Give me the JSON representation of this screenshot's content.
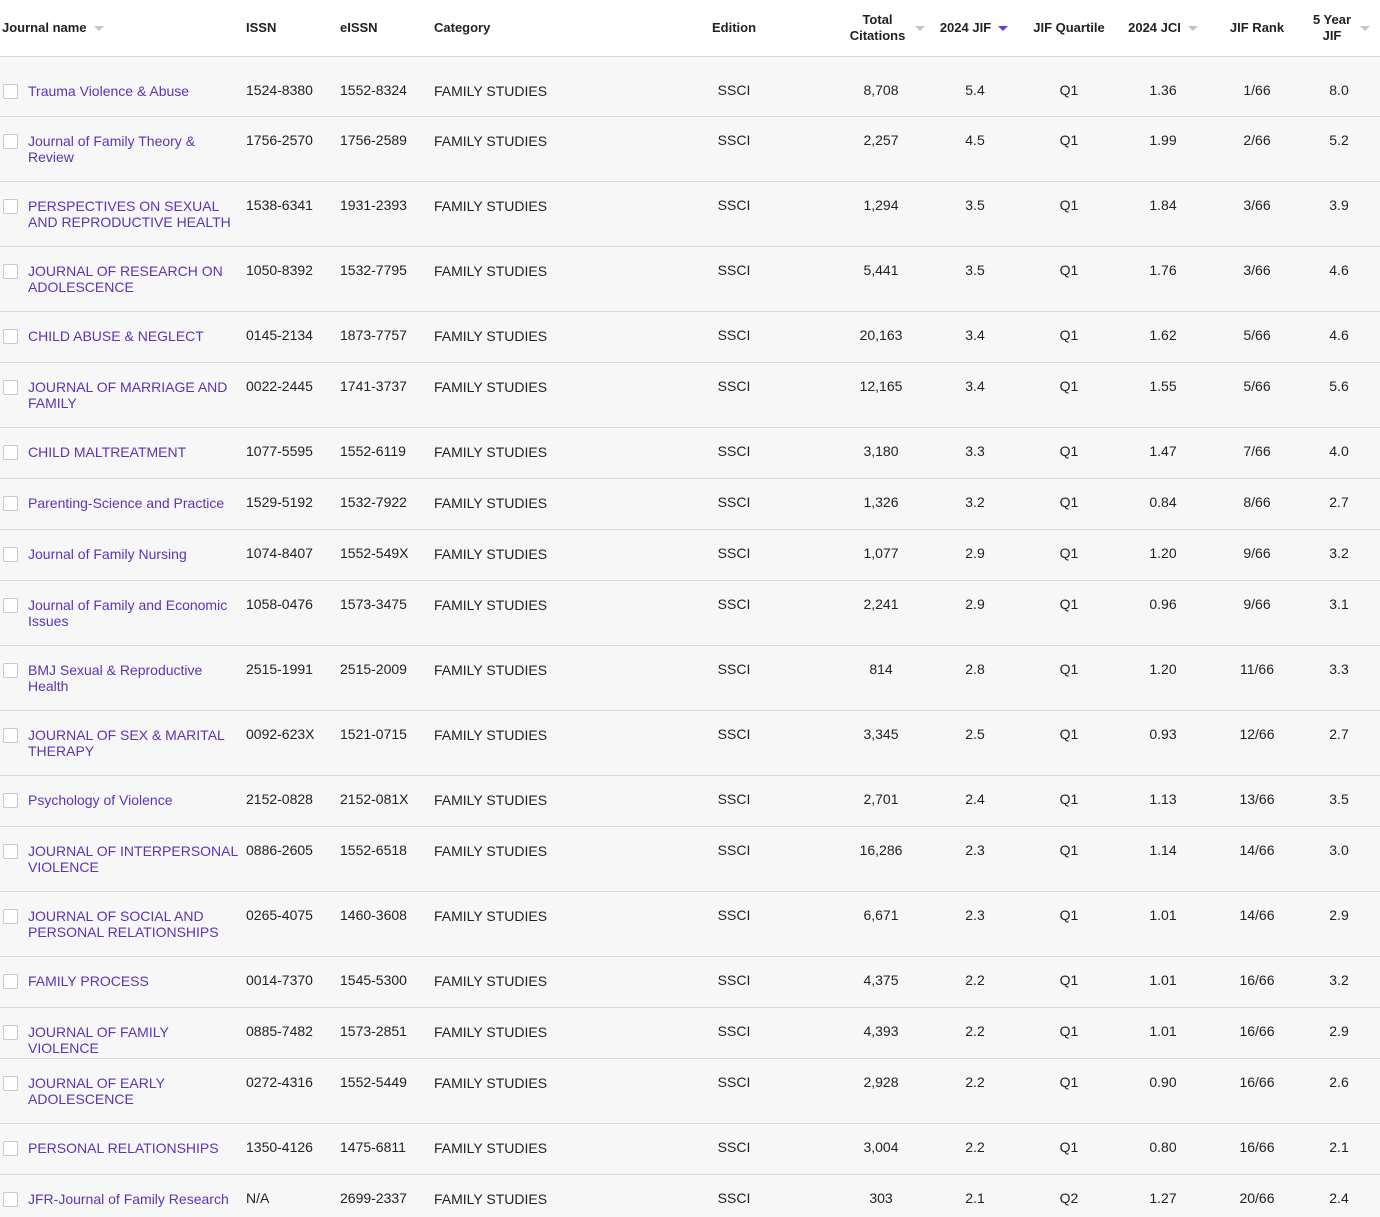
{
  "columns": {
    "journal_name": "Journal name",
    "issn": "ISSN",
    "eissn": "eISSN",
    "category": "Category",
    "edition": "Edition",
    "total_citations": "Total Citations",
    "jif_2024": "2024 JIF",
    "jif_quartile": "JIF Quartile",
    "jci_2024": "2024 JCI",
    "jif_rank": "JIF Rank",
    "five_year_jif": "5 Year JIF"
  },
  "colors": {
    "link": "#5e33b5",
    "sort_active": "#6b3fc8",
    "sort_inactive": "#c4c4c4",
    "row_bg": "#f7f7f7"
  },
  "rows": [
    {
      "name": "Trauma Violence & Abuse",
      "issn": "1524-8380",
      "eissn": "1552-8324",
      "category": "FAMILY STUDIES",
      "edition": "SSCI",
      "citations": "8,708",
      "jif": "5.4",
      "quartile": "Q1",
      "jci": "1.36",
      "rank": "1/66",
      "jif5": "8.0"
    },
    {
      "name": "Journal of Family Theory & Review",
      "issn": "1756-2570",
      "eissn": "1756-2589",
      "category": "FAMILY STUDIES",
      "edition": "SSCI",
      "citations": "2,257",
      "jif": "4.5",
      "quartile": "Q1",
      "jci": "1.99",
      "rank": "2/66",
      "jif5": "5.2"
    },
    {
      "name": "PERSPECTIVES ON SEXUAL AND REPRODUCTIVE HEALTH",
      "issn": "1538-6341",
      "eissn": "1931-2393",
      "category": "FAMILY STUDIES",
      "edition": "SSCI",
      "citations": "1,294",
      "jif": "3.5",
      "quartile": "Q1",
      "jci": "1.84",
      "rank": "3/66",
      "jif5": "3.9"
    },
    {
      "name": "JOURNAL OF RESEARCH ON ADOLESCENCE",
      "issn": "1050-8392",
      "eissn": "1532-7795",
      "category": "FAMILY STUDIES",
      "edition": "SSCI",
      "citations": "5,441",
      "jif": "3.5",
      "quartile": "Q1",
      "jci": "1.76",
      "rank": "3/66",
      "jif5": "4.6"
    },
    {
      "name": "CHILD ABUSE & NEGLECT",
      "issn": "0145-2134",
      "eissn": "1873-7757",
      "category": "FAMILY STUDIES",
      "edition": "SSCI",
      "citations": "20,163",
      "jif": "3.4",
      "quartile": "Q1",
      "jci": "1.62",
      "rank": "5/66",
      "jif5": "4.6"
    },
    {
      "name": "JOURNAL OF MARRIAGE AND FAMILY",
      "issn": "0022-2445",
      "eissn": "1741-3737",
      "category": "FAMILY STUDIES",
      "edition": "SSCI",
      "citations": "12,165",
      "jif": "3.4",
      "quartile": "Q1",
      "jci": "1.55",
      "rank": "5/66",
      "jif5": "5.6"
    },
    {
      "name": "CHILD MALTREATMENT",
      "issn": "1077-5595",
      "eissn": "1552-6119",
      "category": "FAMILY STUDIES",
      "edition": "SSCI",
      "citations": "3,180",
      "jif": "3.3",
      "quartile": "Q1",
      "jci": "1.47",
      "rank": "7/66",
      "jif5": "4.0"
    },
    {
      "name": "Parenting-Science and Practice",
      "issn": "1529-5192",
      "eissn": "1532-7922",
      "category": "FAMILY STUDIES",
      "edition": "SSCI",
      "citations": "1,326",
      "jif": "3.2",
      "quartile": "Q1",
      "jci": "0.84",
      "rank": "8/66",
      "jif5": "2.7"
    },
    {
      "name": "Journal of Family Nursing",
      "issn": "1074-8407",
      "eissn": "1552-549X",
      "category": "FAMILY STUDIES",
      "edition": "SSCI",
      "citations": "1,077",
      "jif": "2.9",
      "quartile": "Q1",
      "jci": "1.20",
      "rank": "9/66",
      "jif5": "3.2"
    },
    {
      "name": "Journal of Family and Economic Issues",
      "issn": "1058-0476",
      "eissn": "1573-3475",
      "category": "FAMILY STUDIES",
      "edition": "SSCI",
      "citations": "2,241",
      "jif": "2.9",
      "quartile": "Q1",
      "jci": "0.96",
      "rank": "9/66",
      "jif5": "3.1"
    },
    {
      "name": "BMJ Sexual & Reproductive Health",
      "issn": "2515-1991",
      "eissn": "2515-2009",
      "category": "FAMILY STUDIES",
      "edition": "SSCI",
      "citations": "814",
      "jif": "2.8",
      "quartile": "Q1",
      "jci": "1.20",
      "rank": "11/66",
      "jif5": "3.3"
    },
    {
      "name": "JOURNAL OF SEX & MARITAL THERAPY",
      "issn": "0092-623X",
      "eissn": "1521-0715",
      "category": "FAMILY STUDIES",
      "edition": "SSCI",
      "citations": "3,345",
      "jif": "2.5",
      "quartile": "Q1",
      "jci": "0.93",
      "rank": "12/66",
      "jif5": "2.7"
    },
    {
      "name": "Psychology of Violence",
      "issn": "2152-0828",
      "eissn": "2152-081X",
      "category": "FAMILY STUDIES",
      "edition": "SSCI",
      "citations": "2,701",
      "jif": "2.4",
      "quartile": "Q1",
      "jci": "1.13",
      "rank": "13/66",
      "jif5": "3.5"
    },
    {
      "name": "JOURNAL OF INTERPERSONAL VIOLENCE",
      "issn": "0886-2605",
      "eissn": "1552-6518",
      "category": "FAMILY STUDIES",
      "edition": "SSCI",
      "citations": "16,286",
      "jif": "2.3",
      "quartile": "Q1",
      "jci": "1.14",
      "rank": "14/66",
      "jif5": "3.0"
    },
    {
      "name": "JOURNAL OF SOCIAL AND PERSONAL RELATIONSHIPS",
      "issn": "0265-4075",
      "eissn": "1460-3608",
      "category": "FAMILY STUDIES",
      "edition": "SSCI",
      "citations": "6,671",
      "jif": "2.3",
      "quartile": "Q1",
      "jci": "1.01",
      "rank": "14/66",
      "jif5": "2.9"
    },
    {
      "name": "FAMILY PROCESS",
      "issn": "0014-7370",
      "eissn": "1545-5300",
      "category": "FAMILY STUDIES",
      "edition": "SSCI",
      "citations": "4,375",
      "jif": "2.2",
      "quartile": "Q1",
      "jci": "1.01",
      "rank": "16/66",
      "jif5": "3.2"
    },
    {
      "name": "JOURNAL OF FAMILY VIOLENCE",
      "issn": "0885-7482",
      "eissn": "1573-2851",
      "category": "FAMILY STUDIES",
      "edition": "SSCI",
      "citations": "4,393",
      "jif": "2.2",
      "quartile": "Q1",
      "jci": "1.01",
      "rank": "16/66",
      "jif5": "2.9"
    },
    {
      "name": "JOURNAL OF EARLY ADOLESCENCE",
      "issn": "0272-4316",
      "eissn": "1552-5449",
      "category": "FAMILY STUDIES",
      "edition": "SSCI",
      "citations": "2,928",
      "jif": "2.2",
      "quartile": "Q1",
      "jci": "0.90",
      "rank": "16/66",
      "jif5": "2.6"
    },
    {
      "name": "PERSONAL RELATIONSHIPS",
      "issn": "1350-4126",
      "eissn": "1475-6811",
      "category": "FAMILY STUDIES",
      "edition": "SSCI",
      "citations": "3,004",
      "jif": "2.2",
      "quartile": "Q1",
      "jci": "0.80",
      "rank": "16/66",
      "jif5": "2.1"
    },
    {
      "name": "JFR-Journal of Family Research",
      "issn": "N/A",
      "eissn": "2699-2337",
      "category": "FAMILY STUDIES",
      "edition": "SSCI",
      "citations": "303",
      "jif": "2.1",
      "quartile": "Q2",
      "jci": "1.27",
      "rank": "20/66",
      "jif5": "2.4"
    }
  ]
}
